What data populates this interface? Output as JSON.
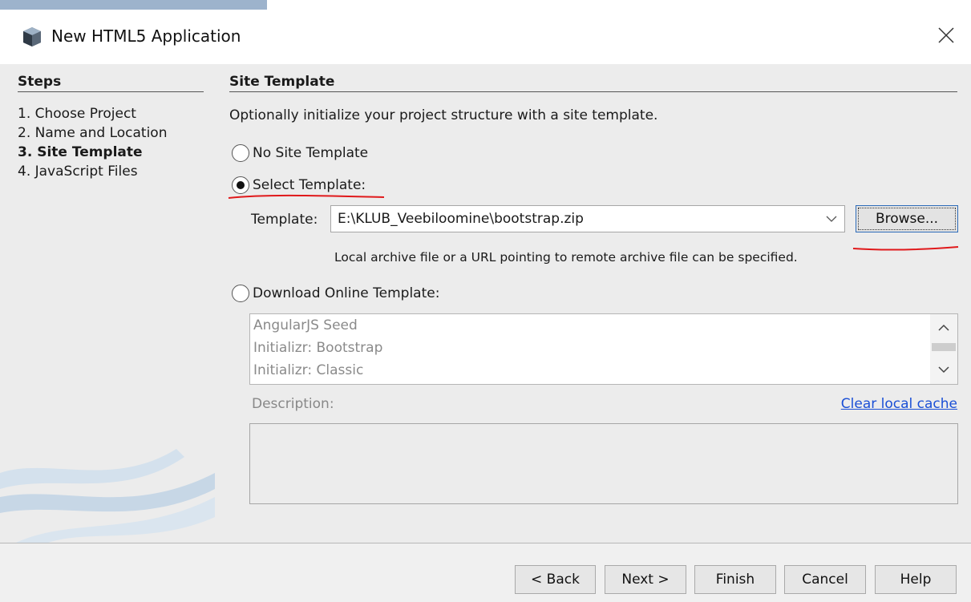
{
  "window": {
    "title": "New HTML5 Application",
    "icon": "cube-icon",
    "close_icon": "close-icon"
  },
  "steps": {
    "heading": "Steps",
    "items": [
      {
        "label": "1.  Choose Project",
        "current": false
      },
      {
        "label": "2.  Name and Location",
        "current": false
      },
      {
        "label": "3.  Site Template",
        "current": true
      },
      {
        "label": "4.  JavaScript Files",
        "current": false
      }
    ]
  },
  "panel": {
    "heading": "Site Template",
    "intro": "Optionally initialize your project structure with a site template.",
    "options": {
      "none": {
        "label": "No Site Template",
        "checked": false
      },
      "select": {
        "label": "Select Template:",
        "checked": true
      },
      "online": {
        "label": "Download Online Template:",
        "checked": false
      }
    },
    "template_label": "Template:",
    "template_value": "E:\\KLUB_Veebiloomine\\bootstrap.zip",
    "browse_label": "Browse...",
    "hint": "Local archive file or a URL pointing to remote archive file can be specified.",
    "online_templates": [
      "AngularJS Seed",
      "Initializr: Bootstrap",
      "Initializr: Classic"
    ],
    "description_label": "Description:",
    "clear_cache_label": "Clear local cache"
  },
  "footer": {
    "back": "< Back",
    "next": "Next >",
    "finish": "Finish",
    "cancel": "Cancel",
    "help": "Help"
  },
  "colors": {
    "annotation": "#e0191b",
    "link": "#1a4fd6",
    "focus_border": "#2d6bb8"
  }
}
